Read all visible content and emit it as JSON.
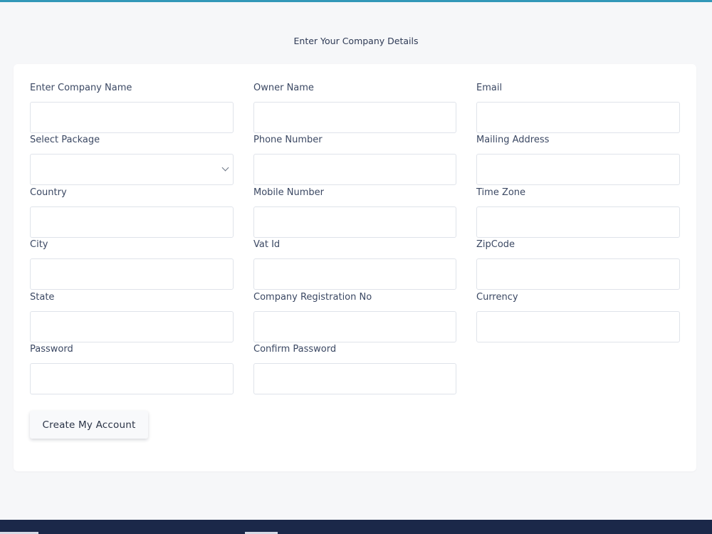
{
  "header": {
    "title": "Enter Your Company Details"
  },
  "form": {
    "fields": [
      {
        "label": "Enter Company Name",
        "value": "",
        "type": "text"
      },
      {
        "label": "Owner Name",
        "value": "",
        "type": "text"
      },
      {
        "label": "Email",
        "value": "",
        "type": "text"
      },
      {
        "label": "Select Package",
        "value": "",
        "type": "select"
      },
      {
        "label": "Phone Number",
        "value": "",
        "type": "text"
      },
      {
        "label": "Mailing Address",
        "value": "",
        "type": "text"
      },
      {
        "label": "Country",
        "value": "",
        "type": "text"
      },
      {
        "label": "Mobile Number",
        "value": "",
        "type": "text"
      },
      {
        "label": "Time Zone",
        "value": "",
        "type": "text"
      },
      {
        "label": "City",
        "value": "",
        "type": "text"
      },
      {
        "label": "Vat Id",
        "value": "",
        "type": "text"
      },
      {
        "label": "ZipCode",
        "value": "",
        "type": "text"
      },
      {
        "label": "State",
        "value": "",
        "type": "text"
      },
      {
        "label": "Company Registration No",
        "value": "",
        "type": "text"
      },
      {
        "label": "Currency",
        "value": "",
        "type": "text"
      },
      {
        "label": "Password",
        "value": "",
        "type": "password"
      },
      {
        "label": "Confirm Password",
        "value": "",
        "type": "password"
      }
    ],
    "submit_label": "Create My Account"
  },
  "colors": {
    "accent_top_bar": "#3298b8",
    "page_background": "#f6f7f9",
    "footer_background": "#1b2849"
  }
}
